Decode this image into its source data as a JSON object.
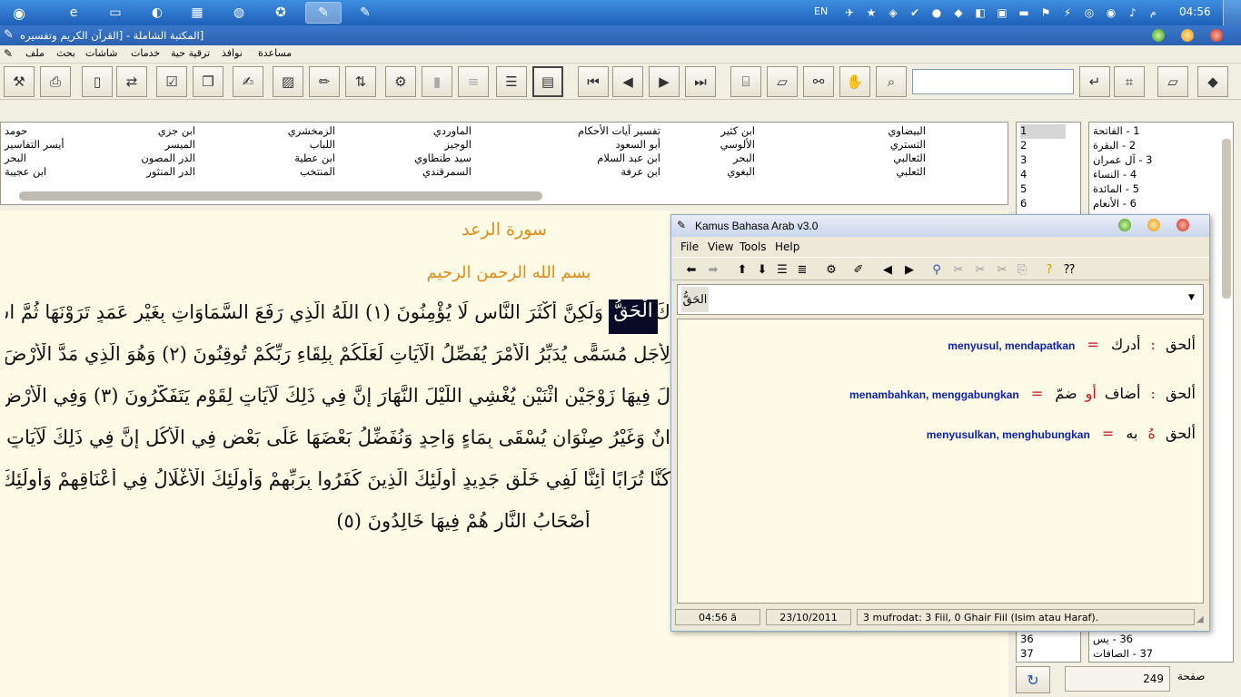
{
  "taskbar": {
    "lang": "EN",
    "clock": "04:56",
    "ampm": "م"
  },
  "window": {
    "title": "[المكتبة الشاملة - [القرآن الكريم وتفسيره"
  },
  "menu": [
    "ملف",
    "بحث",
    "شاشات",
    "خدمات",
    "ترقية حية",
    "نوافذ",
    "مساعدة"
  ],
  "tafsir": {
    "col1": [
      "البيضاوي",
      "التستري",
      "الثعالبي",
      "الثعلبي"
    ],
    "col2": [
      "ابن كثير",
      "الألوسي",
      "البحر",
      "البغوي"
    ],
    "col3": [
      "تفسير آيات الأحكام",
      "أبو السعود",
      "ابن عبد السلام",
      "ابن عرفة"
    ],
    "col4": [
      "الماوردي",
      "الوجيز",
      "سيد طنطاوي",
      "السمرقندي"
    ],
    "col5": [
      "الزمخشري",
      "اللباب",
      "ابن عطية",
      "المنتخب"
    ],
    "col6": [
      "ابن جزي",
      "الميسر",
      "الدر المصون",
      "الدر المنثور"
    ],
    "col7": [
      "حومد",
      "أيسر التفاسير",
      "البحر",
      "ابن عجيبة"
    ]
  },
  "pages": [
    "1",
    "2",
    "3",
    "4",
    "5",
    "6"
  ],
  "pages_bottom": [
    "36",
    "37"
  ],
  "suras": [
    "1 - الفاتحة",
    "2 - البقرة",
    "3 - آل عمران",
    "4 - النساء",
    "5 - المائدة",
    "6 - الأنعام"
  ],
  "suras_bottom": [
    "36 - يس",
    "37 - الصافات"
  ],
  "reader": {
    "surah_title": "سورة الرعد",
    "basmala": "بسم الله الرحمن الرحيم",
    "highlight": "الْحَقُّ",
    "lines": [
      "كَ الْحَقُّ وَلَكِنَّ أَكْثَرَ النَّاسِ لَا يُؤْمِنُونَ (١) اللَّهُ الَّذِي رَفَعَ السَّمَاوَاتِ بِغَيْرِ عَمَدٍ تَرَوْنَهَا ثُمَّ اسْتَوَى",
      "لِأَجَلٍ مُسَمًّى يُدَبِّرُ الْأَمْرَ يُفَصِّلُ الْآيَاتِ لَعَلَّكُمْ بِلِقَاءِ رَبِّكُمْ تُوقِنُونَ (٢) وَهُوَ الَّذِي مَدَّ الْأَرْضَ",
      "لَ فِيهَا زَوْجَيْنِ اثْنَيْنِ يُغْشِي اللَّيْلَ النَّهَارَ إِنَّ فِي ذَلِكَ لَآيَاتٍ لِقَوْمٍ يَتَفَكَّرُونَ (٣) وَفِي الْأَرْضِ قِطَعٌ",
      "انٌ وَغَيْرُ صِنْوَانٍ يُسْقَى بِمَاءٍ وَاحِدٍ وَنُفَضِّلُ بَعْضَهَا عَلَى بَعْضٍ فِي الْأُكُلِ إِنَّ فِي ذَلِكَ لَآيَاتٍ لِقَوْمٍ",
      "كُنَّا تُرَابًا أَئِنَّا لَفِي خَلْقٍ جَدِيدٍ أُولَئِكَ الَّذِينَ كَفَرُوا بِرَبِّهِمْ وَأُولَئِكَ الْأَغْلَالُ فِي أَعْنَاقِهِمْ وَأُولَئِكَ",
      "أَصْحَابُ النَّارِ هُمْ فِيهَا خَالِدُونَ (٥)"
    ]
  },
  "kamus": {
    "title": "Kamus Bahasa Arab v3.0",
    "menu": {
      "file": "File",
      "view": "View",
      "tools": "Tools",
      "help": "Help"
    },
    "search_value": "الحَقُّ",
    "entries": [
      {
        "word": "ألحق",
        "sep": ":",
        "arabic": "أدرك",
        "eq": "=",
        "trans": "menyusul, mendapatkan",
        "extra": ""
      },
      {
        "word": "ألحق",
        "sep": ":",
        "arabic": "أضاف",
        "extra": "أو",
        "arabic2": "ضمّ",
        "eq": "=",
        "trans": "menambahkan, menggabungkan"
      },
      {
        "word": "ألحق",
        "sep": "",
        "arabic": "به",
        "extra": "هُ",
        "eq": "=",
        "trans": "menyusulkan, menghubungkan"
      }
    ],
    "status": {
      "time": "04:56 ã",
      "date": "23/10/2011",
      "info": "3 mufrodat: 3 Fiil, 0 Ghair Fiil (Isim atau Haraf)."
    }
  },
  "bottom": {
    "page_label": "صفحة",
    "page_value": "249"
  },
  "colors": {
    "taskbar": "#2c6cc8",
    "reader_bg": "#fdfbe6",
    "surah_title": "#e08a1c",
    "trans_blue": "#0a1fb4",
    "red": "#d0101a"
  }
}
